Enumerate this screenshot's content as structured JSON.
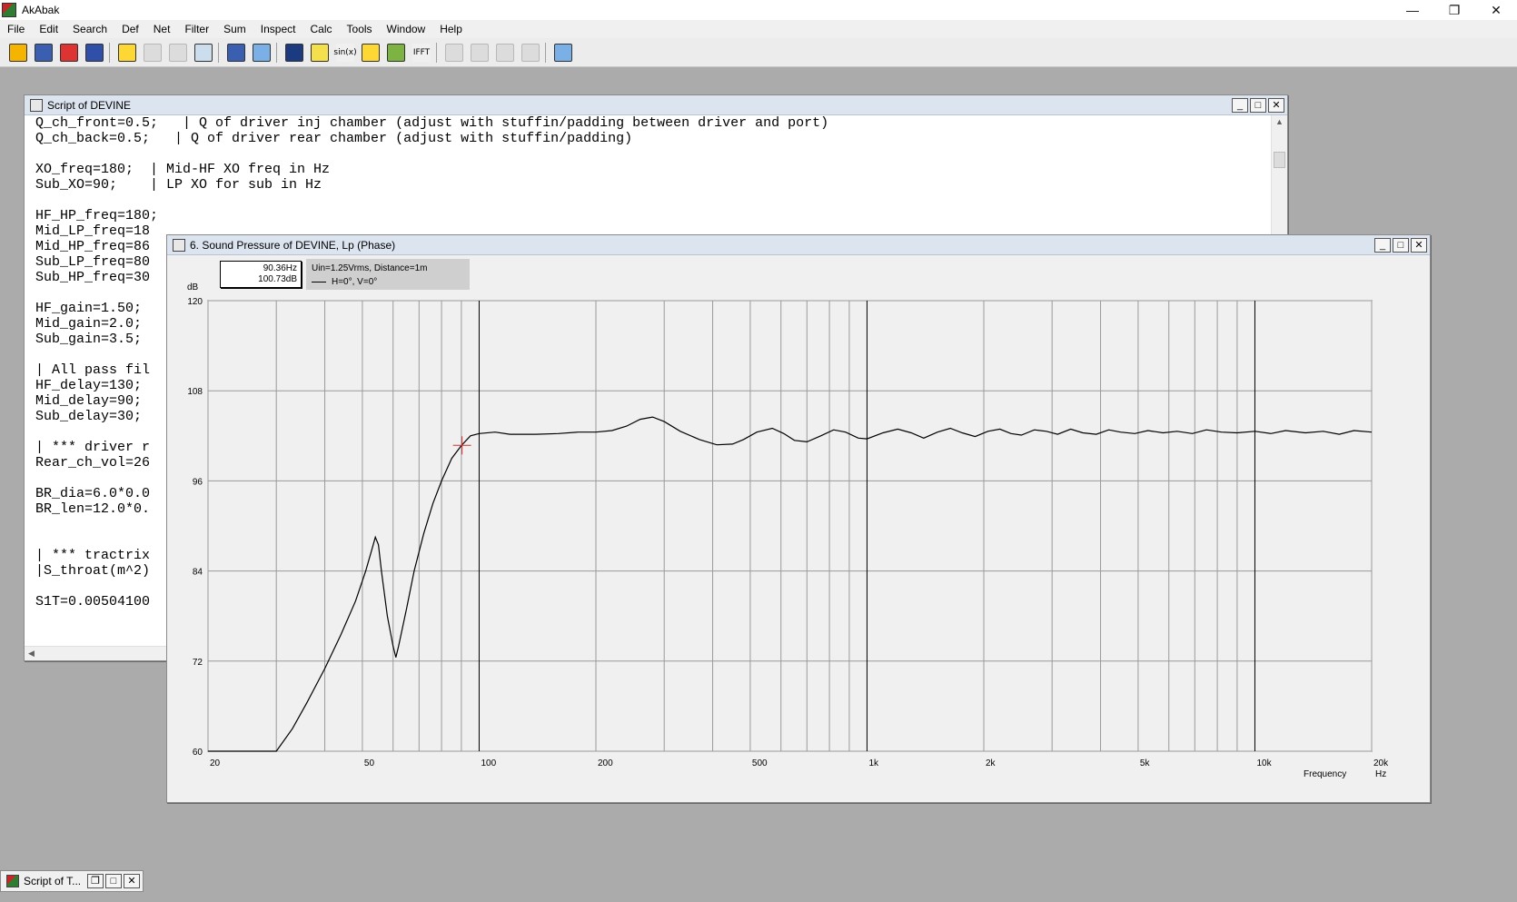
{
  "app": {
    "title": "AkAbak",
    "window_controls": {
      "minimize": "—",
      "restore": "❐",
      "close": "✕"
    }
  },
  "menu": [
    "File",
    "Edit",
    "Search",
    "Def",
    "Net",
    "Filter",
    "Sum",
    "Inspect",
    "Calc",
    "Tools",
    "Window",
    "Help"
  ],
  "toolbar": {
    "buttons": [
      {
        "name": "open-icon",
        "color": "#f4b400",
        "enabled": true
      },
      {
        "name": "save-icon",
        "color": "#3a5fb0",
        "enabled": true
      },
      {
        "name": "network-icon",
        "color": "#d33",
        "enabled": true
      },
      {
        "name": "driver-icon",
        "color": "#2f4fa8",
        "enabled": true
      },
      {
        "name": "clipboard-icon",
        "color": "#fdd835",
        "enabled": true
      },
      {
        "name": "edit-icon",
        "color": "#dcdcdc",
        "enabled": false
      },
      {
        "name": "list-icon",
        "color": "#dcdcdc",
        "enabled": false
      },
      {
        "name": "axes-icon",
        "color": "#cde",
        "enabled": true
      },
      {
        "name": "bracket-icon",
        "color": "#3a5fb0",
        "enabled": true
      },
      {
        "name": "probe-icon",
        "color": "#7ab0e6",
        "enabled": true
      },
      {
        "name": "speaker-icon",
        "color": "#1b3a80",
        "enabled": true
      },
      {
        "name": "filter-icon",
        "color": "#f4e04d",
        "enabled": true
      },
      {
        "name": "sine-icon",
        "color": "#f0f0f0",
        "enabled": true,
        "text": "sin(x)"
      },
      {
        "name": "sum-plot-icon",
        "color": "#fdd835",
        "enabled": true
      },
      {
        "name": "sum-plot2-icon",
        "color": "#7cb342",
        "enabled": true
      },
      {
        "name": "ifft-icon",
        "color": "#f0f0f0",
        "enabled": true,
        "text": "IFFT"
      },
      {
        "name": "graph-disabled-1-icon",
        "color": "#dcdcdc",
        "enabled": false
      },
      {
        "name": "graph-disabled-2-icon",
        "color": "#dcdcdc",
        "enabled": false
      },
      {
        "name": "graph-disabled-3-icon",
        "color": "#dcdcdc",
        "enabled": false
      },
      {
        "name": "graph-disabled-4-icon",
        "color": "#dcdcdc",
        "enabled": false
      },
      {
        "name": "compare-plot-icon",
        "color": "#7ab0e6",
        "enabled": true
      }
    ]
  },
  "script_window": {
    "title": "Script of DEVINE",
    "lines": [
      "Q_ch_front=0.5;   | Q of driver inj chamber (adjust with stuffin/padding between driver and port)",
      "Q_ch_back=0.5;   | Q of driver rear chamber (adjust with stuffin/padding)",
      "",
      "XO_freq=180;  | Mid-HF XO freq in Hz",
      "Sub_XO=90;    | LP XO for sub in Hz",
      "",
      "HF_HP_freq=180;",
      "Mid_LP_freq=18",
      "Mid_HP_freq=86",
      "Sub_LP_freq=80",
      "Sub_HP_freq=30",
      "",
      "HF_gain=1.50;",
      "Mid_gain=2.0;",
      "Sub_gain=3.5;",
      "",
      "| All pass fil",
      "HF_delay=130;",
      "Mid_delay=90;",
      "Sub_delay=30;",
      "",
      "| *** driver r",
      "Rear_ch_vol=26",
      "",
      "BR_dia=6.0*0.0",
      "BR_len=12.0*0.",
      "",
      "",
      "| *** tractrix",
      "|S_throat(m^2)",
      "",
      "S1T=0.00504100"
    ]
  },
  "plot_window": {
    "title": "6. Sound Pressure of DEVINE, Lp (Phase)",
    "readout": {
      "freq": "90.36Hz",
      "level": "100.73dB"
    },
    "legend": {
      "line1": "Uin=1.25Vrms, Distance=1m",
      "line2": "H=0°, V=0°"
    }
  },
  "chart_data": {
    "type": "line",
    "title": "6. Sound Pressure of DEVINE, Lp (Phase)",
    "xlabel": "Frequency",
    "xunit": "Hz",
    "ylabel": "dB",
    "xscale": "log",
    "xlim": [
      20,
      20000
    ],
    "ylim": [
      60,
      120
    ],
    "y_ticks": [
      60,
      72,
      84,
      96,
      108,
      120
    ],
    "x_ticks": [
      20,
      50,
      100,
      200,
      500,
      1000,
      2000,
      5000,
      10000,
      20000
    ],
    "x_tick_labels": [
      "20",
      "50",
      "100",
      "200",
      "500",
      "1k",
      "2k",
      "5k",
      "10k",
      "20k"
    ],
    "grid": true,
    "cursor": {
      "x": 90.36,
      "y": 100.73
    },
    "series": [
      {
        "color": "#000000",
        "points": [
          [
            20,
            60
          ],
          [
            26,
            60
          ],
          [
            30,
            60
          ],
          [
            33,
            63
          ],
          [
            36,
            66.5
          ],
          [
            40,
            71
          ],
          [
            44,
            75.5
          ],
          [
            48,
            80
          ],
          [
            51,
            84
          ],
          [
            53,
            87
          ],
          [
            54,
            88.5
          ],
          [
            55,
            87.5
          ],
          [
            56,
            84
          ],
          [
            58,
            78
          ],
          [
            60,
            74
          ],
          [
            61,
            72.5
          ],
          [
            62,
            74
          ],
          [
            65,
            79
          ],
          [
            68,
            84
          ],
          [
            72,
            89
          ],
          [
            76,
            93
          ],
          [
            80,
            96
          ],
          [
            85,
            99
          ],
          [
            90,
            100.7
          ],
          [
            95,
            102
          ],
          [
            100,
            102.3
          ],
          [
            110,
            102.5
          ],
          [
            120,
            102.2
          ],
          [
            140,
            102.2
          ],
          [
            160,
            102.3
          ],
          [
            180,
            102.5
          ],
          [
            200,
            102.5
          ],
          [
            220,
            102.7
          ],
          [
            240,
            103.3
          ],
          [
            260,
            104.2
          ],
          [
            280,
            104.5
          ],
          [
            300,
            103.9
          ],
          [
            330,
            102.6
          ],
          [
            370,
            101.5
          ],
          [
            410,
            100.8
          ],
          [
            450,
            100.9
          ],
          [
            480,
            101.5
          ],
          [
            520,
            102.5
          ],
          [
            570,
            103
          ],
          [
            610,
            102.3
          ],
          [
            650,
            101.4
          ],
          [
            700,
            101.2
          ],
          [
            760,
            102
          ],
          [
            820,
            102.8
          ],
          [
            880,
            102.5
          ],
          [
            950,
            101.7
          ],
          [
            1000,
            101.6
          ],
          [
            1100,
            102.4
          ],
          [
            1200,
            102.9
          ],
          [
            1300,
            102.4
          ],
          [
            1400,
            101.7
          ],
          [
            1520,
            102.5
          ],
          [
            1640,
            103
          ],
          [
            1760,
            102.4
          ],
          [
            1900,
            101.9
          ],
          [
            2050,
            102.6
          ],
          [
            2200,
            102.9
          ],
          [
            2350,
            102.3
          ],
          [
            2500,
            102.1
          ],
          [
            2700,
            102.8
          ],
          [
            2900,
            102.6
          ],
          [
            3100,
            102.2
          ],
          [
            3350,
            102.9
          ],
          [
            3600,
            102.4
          ],
          [
            3900,
            102.2
          ],
          [
            4200,
            102.8
          ],
          [
            4500,
            102.5
          ],
          [
            4900,
            102.3
          ],
          [
            5300,
            102.7
          ],
          [
            5800,
            102.4
          ],
          [
            6300,
            102.6
          ],
          [
            6900,
            102.3
          ],
          [
            7500,
            102.8
          ],
          [
            8200,
            102.5
          ],
          [
            9000,
            102.4
          ],
          [
            10000,
            102.6
          ],
          [
            11000,
            102.3
          ],
          [
            12000,
            102.7
          ],
          [
            13500,
            102.4
          ],
          [
            15000,
            102.6
          ],
          [
            16500,
            102.2
          ],
          [
            18000,
            102.7
          ],
          [
            20000,
            102.5
          ]
        ]
      }
    ]
  },
  "minimized_window": {
    "title": "Script of T..."
  }
}
